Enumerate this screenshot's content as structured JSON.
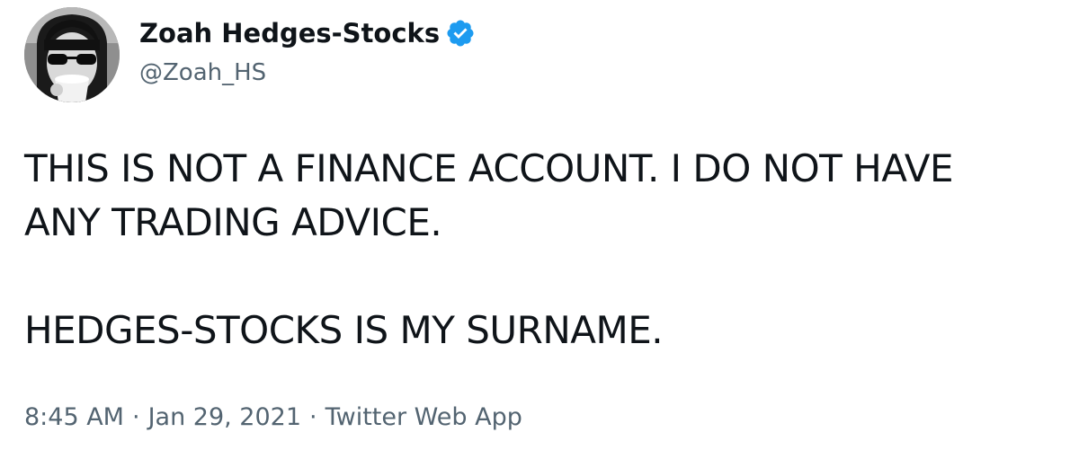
{
  "tweet": {
    "author": {
      "display_name": "Zoah Hedges-Stocks",
      "handle": "@Zoah_HS",
      "verified_icon": "verified-badge-icon",
      "avatar_icon": "profile-photo"
    },
    "text_lines": [
      "THIS IS NOT A FINANCE ACCOUNT. I DO NOT HAVE",
      "ANY TRADING ADVICE.",
      "HEDGES-STOCKS IS MY SURNAME."
    ],
    "meta": {
      "time": "8:45 AM",
      "separator": "·",
      "date": "Jan 29, 2021",
      "source": "Twitter Web App"
    }
  },
  "colors": {
    "text_primary": "#0f1419",
    "text_secondary": "#536471",
    "verified_blue": "#1d9bf0",
    "background": "#ffffff"
  }
}
